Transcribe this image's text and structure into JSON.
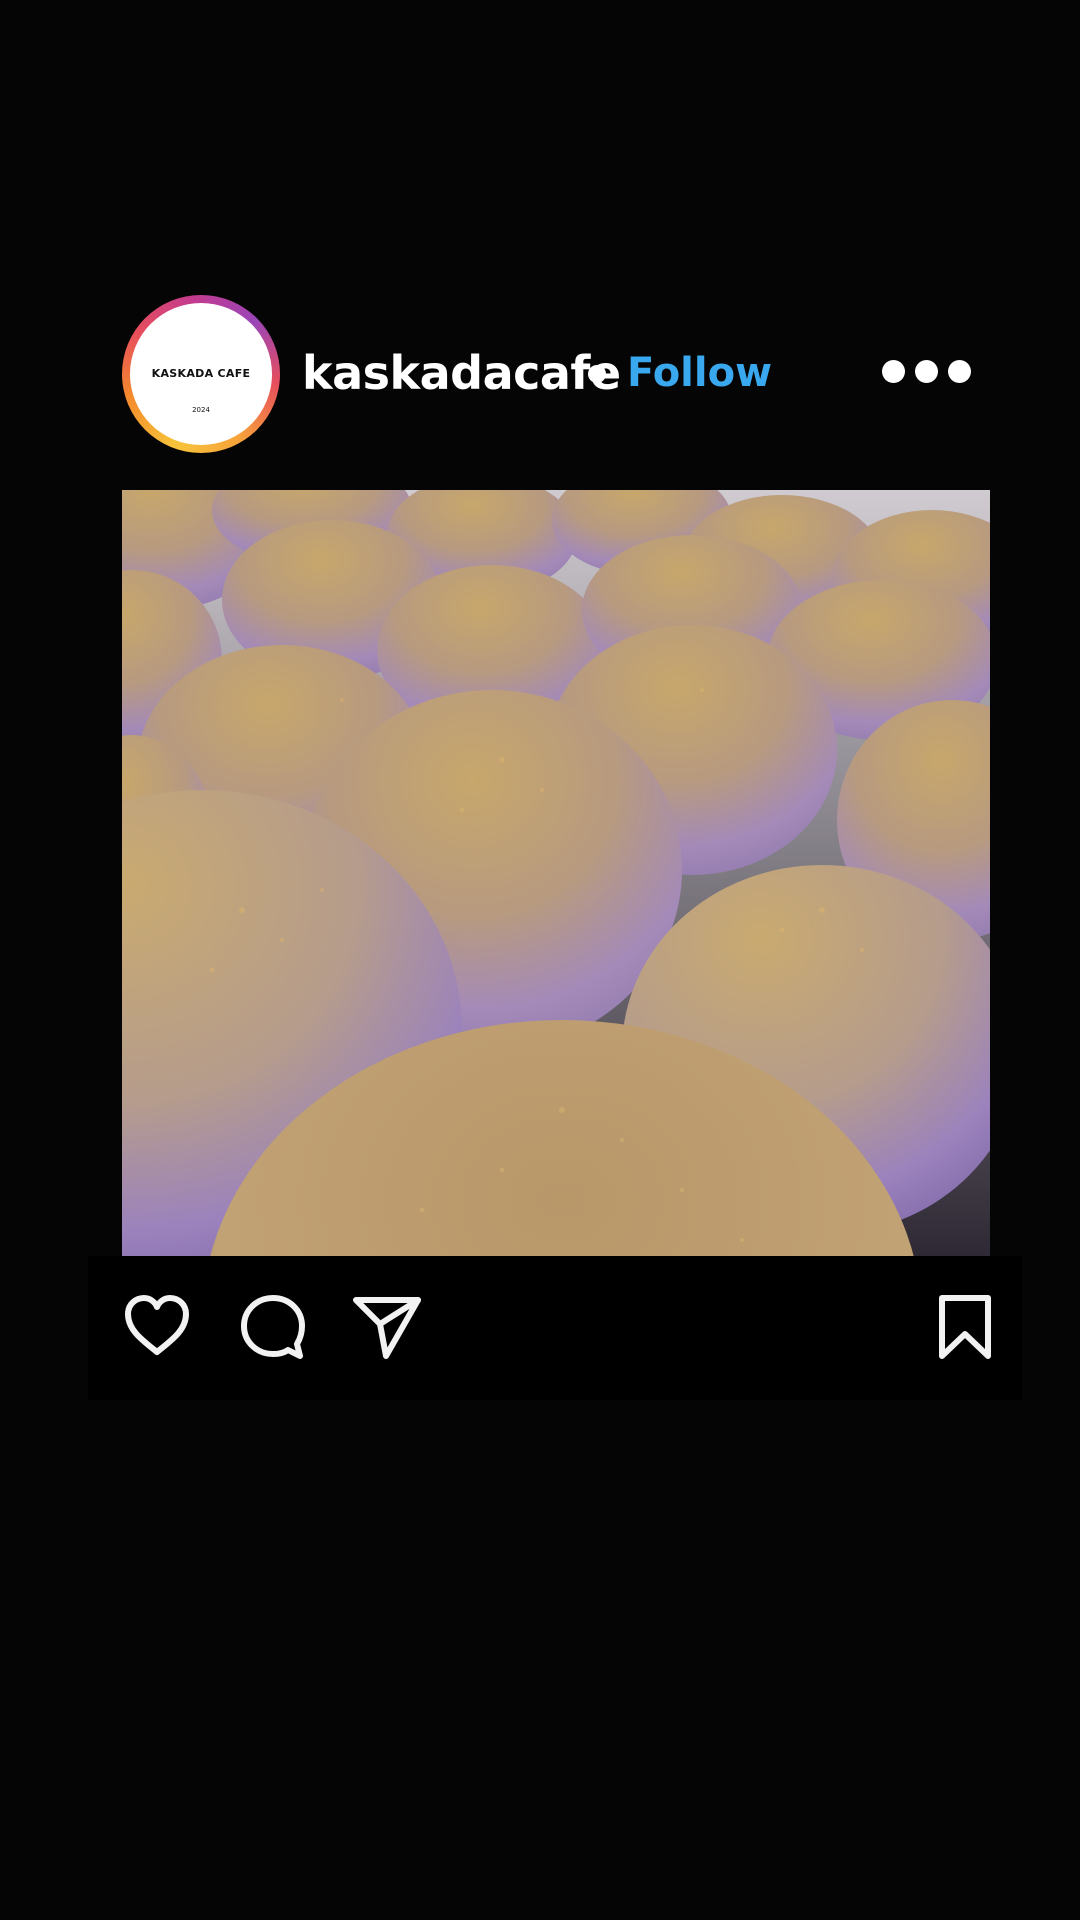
{
  "post": {
    "account": {
      "username": "kaskadacafe",
      "avatar_text": "KASKADA CAFE",
      "avatar_year": "2024",
      "follow_label": "Follow"
    },
    "more_icon": "more-horizontal-icon",
    "image_alt": "Purple ube mochi buns dusted with toasted powder",
    "actions": {
      "like_icon": "heart-icon",
      "comment_icon": "comment-bubble-icon",
      "share_icon": "paper-plane-icon",
      "save_icon": "bookmark-icon"
    },
    "colors": {
      "background": "#050505",
      "follow": "#3aa8ee",
      "text": "#ffffff",
      "ring": [
        "#f7c33a",
        "#f58b2c",
        "#e74e5c",
        "#c33b8f",
        "#9a45b8"
      ]
    }
  }
}
